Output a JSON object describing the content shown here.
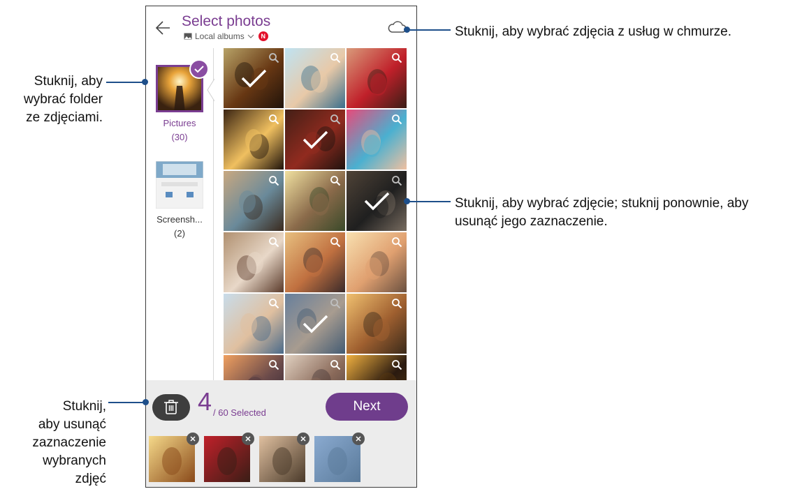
{
  "header": {
    "title": "Select photos",
    "subtitle": "Local albums",
    "badge": "N"
  },
  "folders": [
    {
      "label": "Pictures",
      "count": "(30)",
      "selected": true
    },
    {
      "label": "Screensh...",
      "count": "(2)",
      "selected": false
    }
  ],
  "grid": {
    "selected_flags": [
      true,
      false,
      false,
      false,
      true,
      false,
      false,
      false,
      true,
      false,
      false,
      false,
      false,
      true,
      false,
      false,
      false,
      false
    ]
  },
  "bottom": {
    "selected_count": "4",
    "selected_of": "/ 60 Selected",
    "next_label": "Next",
    "thumb_count": 4
  },
  "annotations": {
    "cloud": "Stuknij, aby wybrać zdjęcia z usług w chmurze.",
    "folder": [
      "Stuknij, aby",
      "wybrać folder",
      "ze zdjęciami."
    ],
    "photo": [
      "Stuknij, aby wybrać zdjęcie; stuknij ponownie, aby",
      "usunąć jego zaznaczenie."
    ],
    "delete": [
      "Stuknij,",
      "aby usunąć",
      "zaznaczenie",
      "wybranych",
      "zdjęć"
    ]
  },
  "colors": {
    "accent": "#7a3d91",
    "next_button": "#6f3d8c",
    "callout": "#1e4f8a",
    "badge": "#e3102a"
  }
}
